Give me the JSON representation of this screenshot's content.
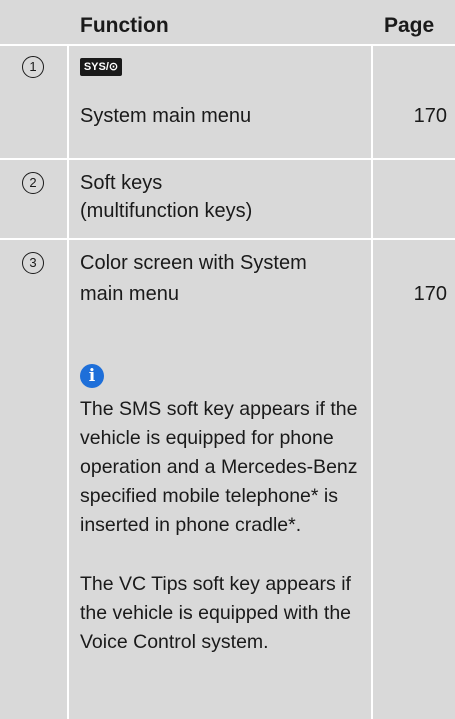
{
  "header": {
    "function": "Function",
    "page": "Page"
  },
  "rows": [
    {
      "num": "1",
      "key_label": "SYS/⊙",
      "text": "System main menu",
      "page": "170"
    },
    {
      "num": "2",
      "text_line1": "Soft keys",
      "text_line2": "(multifunction keys)"
    },
    {
      "num": "3",
      "text_line1": "Color screen with System",
      "text_line2": "main menu",
      "page": "170",
      "info_icon": "info-icon",
      "note1": "The SMS soft key appears if the vehicle is equipped for phone operation and a Mercedes-Benz specified mobile telephone* is inserted in phone cradle*.",
      "note2": "The VC Tips soft key appears if the vehicle is equipped with the Voice Control system."
    }
  ]
}
